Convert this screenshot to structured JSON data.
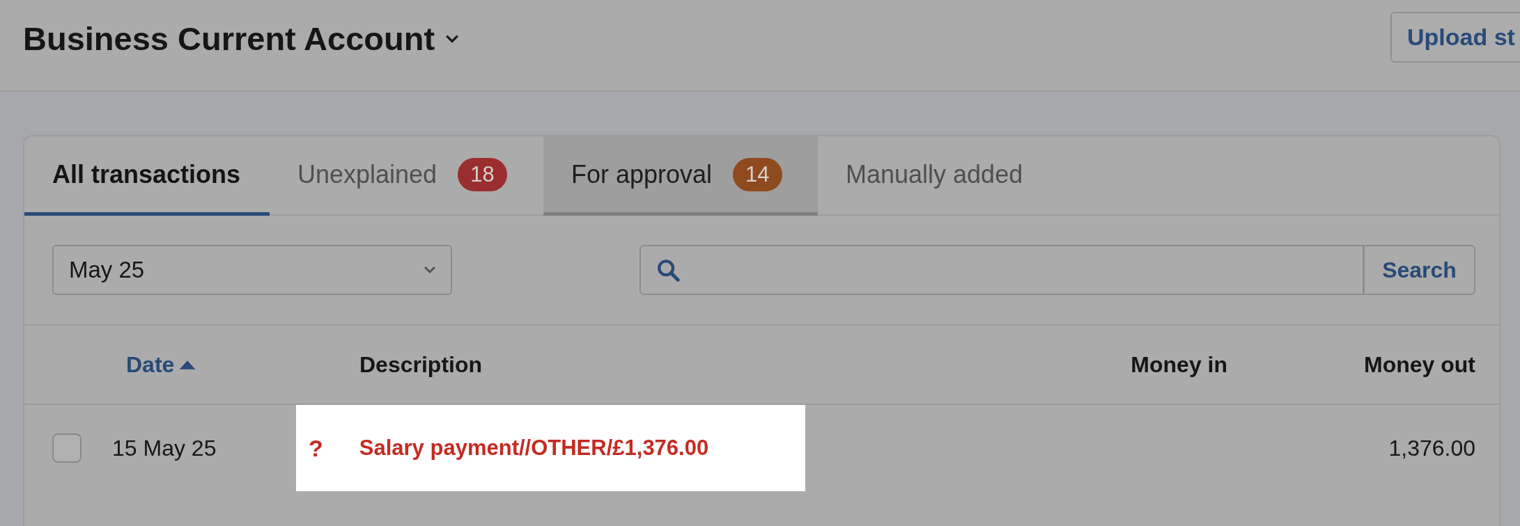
{
  "header": {
    "title": "Business Current Account",
    "upload_button": "Upload st"
  },
  "tabs": [
    {
      "label": "All transactions",
      "selected": true,
      "hovered": false
    },
    {
      "label": "Unexplained",
      "selected": false,
      "hovered": false,
      "badge": "18",
      "color": "#9a2e2e"
    },
    {
      "label": "For approval",
      "selected": false,
      "hovered": true,
      "badge": "14",
      "color": "#8f4a1e"
    },
    {
      "label": "Manually added",
      "selected": false,
      "hovered": false
    }
  ],
  "filters": {
    "period": "May 25",
    "search_button": "Search"
  },
  "table": {
    "columns": [
      {
        "label": "Date",
        "sorted": true
      },
      {
        "label": "Description"
      },
      {
        "label": "Money in"
      },
      {
        "label": "Money out"
      }
    ],
    "rows": [
      {
        "checked": false,
        "date": "15 May 25",
        "status_icon": "?",
        "description": "Salary payment//OTHER/£1,376.00",
        "highlighted": true,
        "money_out": "1,376.00"
      }
    ]
  }
}
